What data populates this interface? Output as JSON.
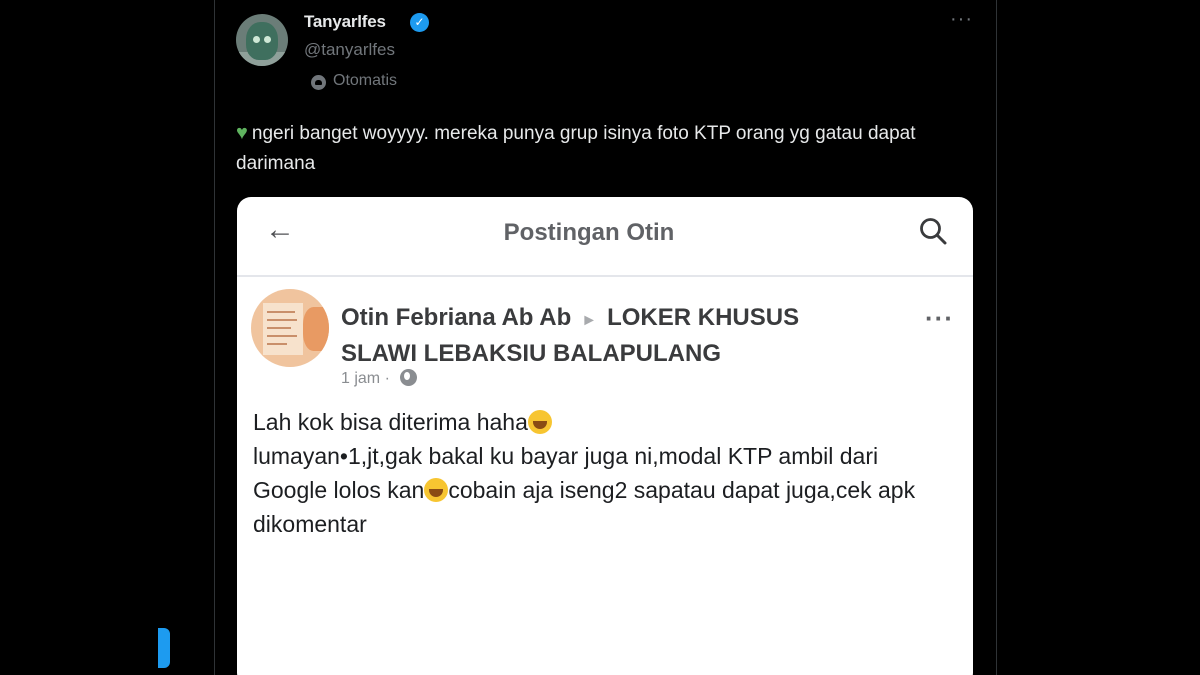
{
  "tweet": {
    "display_name": "Tanyarlfes",
    "handle": "@tanyarlfes",
    "auto_label": "Otomatis",
    "more": "···",
    "verified_mark": "✓",
    "heart_icon": "green-heart",
    "text": "ngeri banget woyyyy. mereka punya grup isinya foto KTP orang yg gatau dapat darimana"
  },
  "embedded_post": {
    "header_title": "Postingan Otin",
    "back_glyph": "←",
    "poster_name": "Otin Febriana Ab Ab",
    "arrow_glyph": "►",
    "group_name": "LOKER KHUSUS SLAWI LEBAKSIU BALAPULANG",
    "time": "1 jam",
    "separator": "·",
    "more": "···",
    "body_line1": "Lah kok bisa diterima haha",
    "body_line2": "lumayan•1,jt,gak bakal ku bayar juga ni,modal KTP ambil dari Google lolos kan",
    "body_line3": "cobain aja iseng2 sapatau dapat juga,cek apk dikomentar"
  },
  "colors": {
    "background": "#000000",
    "verified": "#1d9bf0",
    "card": "#ffffff"
  }
}
